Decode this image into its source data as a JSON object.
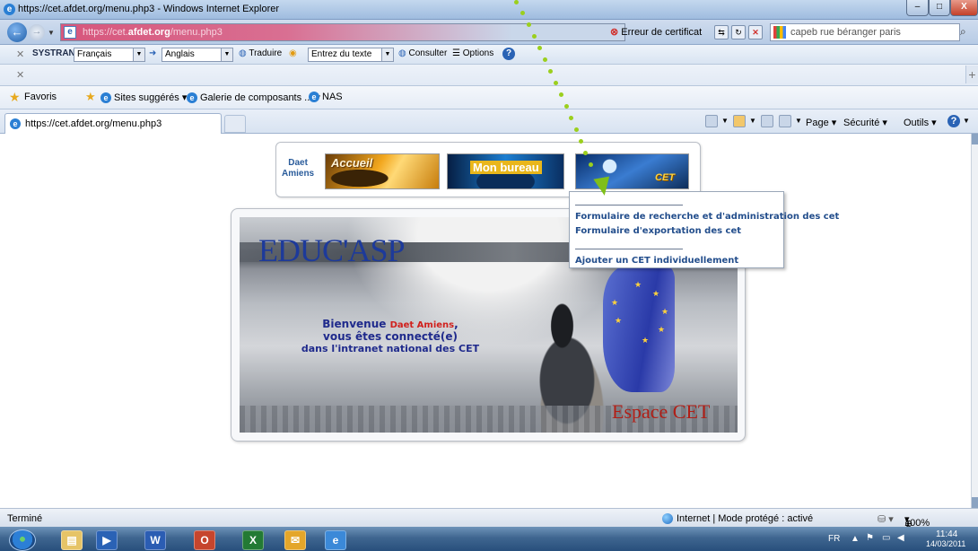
{
  "window": {
    "title": "https://cet.afdet.org/menu.php3 - Windows Internet Explorer",
    "min": "–",
    "max": "□",
    "close": "X"
  },
  "address": {
    "url_prefix": "https://cet.",
    "url_domain": "afdet.org",
    "url_suffix": "/menu.php3",
    "cert_error": "Erreur de certificat",
    "search_text": "capeb rue béranger paris"
  },
  "systran": {
    "brand": "SYSTRAN",
    "from_lang": "Français",
    "to_lang": "Anglais",
    "translate": "Traduire",
    "input_mode": "Entrez du texte",
    "consult": "Consulter",
    "options": "Options"
  },
  "favorites": {
    "label": "Favoris",
    "items": [
      "Sites suggérés ▾",
      "Galerie de composants ... ▾",
      "NAS"
    ]
  },
  "tab": {
    "label": "https://cet.afdet.org/menu.php3"
  },
  "commandbar": {
    "page": "Page ▾",
    "security": "Sécurité ▾",
    "tools": "Outils ▾"
  },
  "menu": {
    "site_name_line1": "Daet",
    "site_name_line2": "Amiens",
    "banners": [
      "Accueil",
      "Mon bureau",
      "CET"
    ],
    "dropdown_items": [
      "Formulaire de recherche et d'administration des cet",
      "Formulaire d'exportation des cet",
      "Ajouter un CET individuellement"
    ]
  },
  "hero": {
    "logo": "EDUC'ASP",
    "welcome_prefix": "Bienvenue ",
    "user_name": "Daet Amiens",
    "welcome_suffix": ",",
    "line2": "vous êtes connecté(e)",
    "line3": "dans l'intranet national des CET",
    "espace": "Espace CET"
  },
  "status": {
    "left": "Terminé",
    "zone": "Internet | Mode protégé : activé",
    "zoom": "100%"
  },
  "taskbar": {
    "lang": "FR",
    "time": "11:44",
    "date": "14/03/2011"
  },
  "colors": {
    "accent": "#234e8c",
    "welcome_blue": "#1f2a8c",
    "user_red": "#d1201c",
    "espace_red": "#b01e16",
    "arrow_green": "#9bcf1d"
  }
}
